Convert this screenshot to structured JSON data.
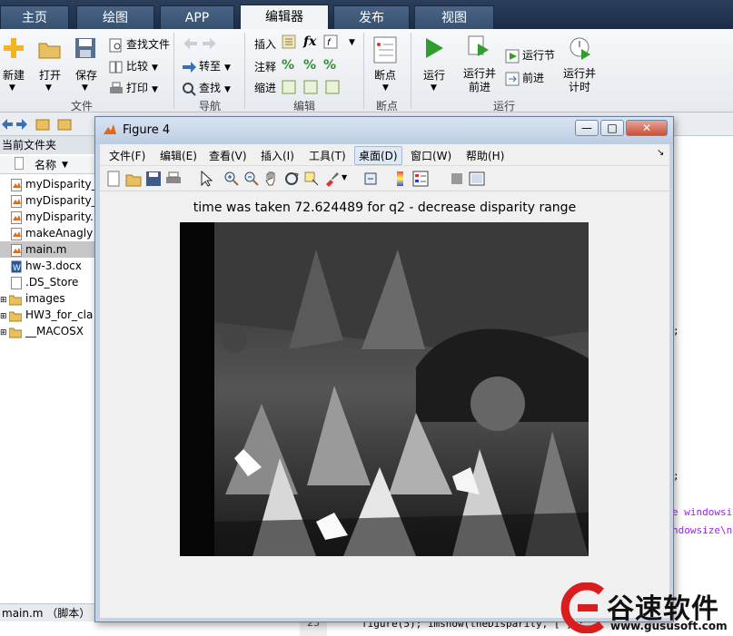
{
  "tabs": [
    {
      "label": "主页"
    },
    {
      "label": "绘图"
    },
    {
      "label": "APP"
    },
    {
      "label": "编辑器",
      "active": true
    },
    {
      "label": "发布"
    },
    {
      "label": "视图"
    }
  ],
  "ribbon": {
    "file": {
      "new": "新建",
      "open": "打开",
      "save": "保存",
      "find_files": "查找文件",
      "compare": "比较",
      "print": "打印",
      "group": "文件"
    },
    "navigate": {
      "goto": "转至",
      "find": "查找",
      "group": "导航"
    },
    "edit": {
      "insert": "插入",
      "comment": "注释",
      "indent": "缩进",
      "fx": "fx",
      "group": "编辑"
    },
    "breakpoints": {
      "label": "断点",
      "group": "断点"
    },
    "run": {
      "run": "运行",
      "run_advance": "运行并\n前进",
      "run_section": "运行节",
      "advance": "前进",
      "run_time": "运行并\n计时",
      "group": "运行"
    }
  },
  "filebrowser": {
    "title": "当前文件夹",
    "col_name": "名称",
    "items": [
      {
        "name": "myDisparity_",
        "type": "m"
      },
      {
        "name": "myDisparity_",
        "type": "m"
      },
      {
        "name": "myDisparity.",
        "type": "m"
      },
      {
        "name": "makeAnagly",
        "type": "m"
      },
      {
        "name": "main.m",
        "type": "m",
        "selected": true
      },
      {
        "name": "hw-3.docx",
        "type": "doc"
      },
      {
        "name": ".DS_Store",
        "type": "file"
      },
      {
        "name": "images",
        "type": "folder"
      },
      {
        "name": "HW3_for_cla",
        "type": "folder"
      },
      {
        "name": "__MACOSX",
        "type": "folder"
      }
    ],
    "status": "main.m （脚本）"
  },
  "editor": {
    "line_number": "23",
    "code_bottom": "figure(5); imshow(theDisparity, [  ]);",
    "frag1": ";",
    "frag2": ";",
    "frag3": "e windowsi",
    "frag4": "ndowsize\\n"
  },
  "figure": {
    "title": "Figure 4",
    "menu": [
      "文件(F)",
      "编辑(E)",
      "查看(V)",
      "插入(I)",
      "工具(T)",
      "桌面(D)",
      "窗口(W)",
      "帮助(H)"
    ],
    "axes_title": "time was taken 72.624489 for q2 - decrease disparity range"
  },
  "watermark": {
    "text": "谷速软件",
    "url": "www.gususoft.com"
  },
  "colors": {
    "tab_bar": "#1b2c45",
    "run_green": "#2f9e2f",
    "matlab_orange": "#e06a1c",
    "watermark_red": "#d81e1e"
  }
}
